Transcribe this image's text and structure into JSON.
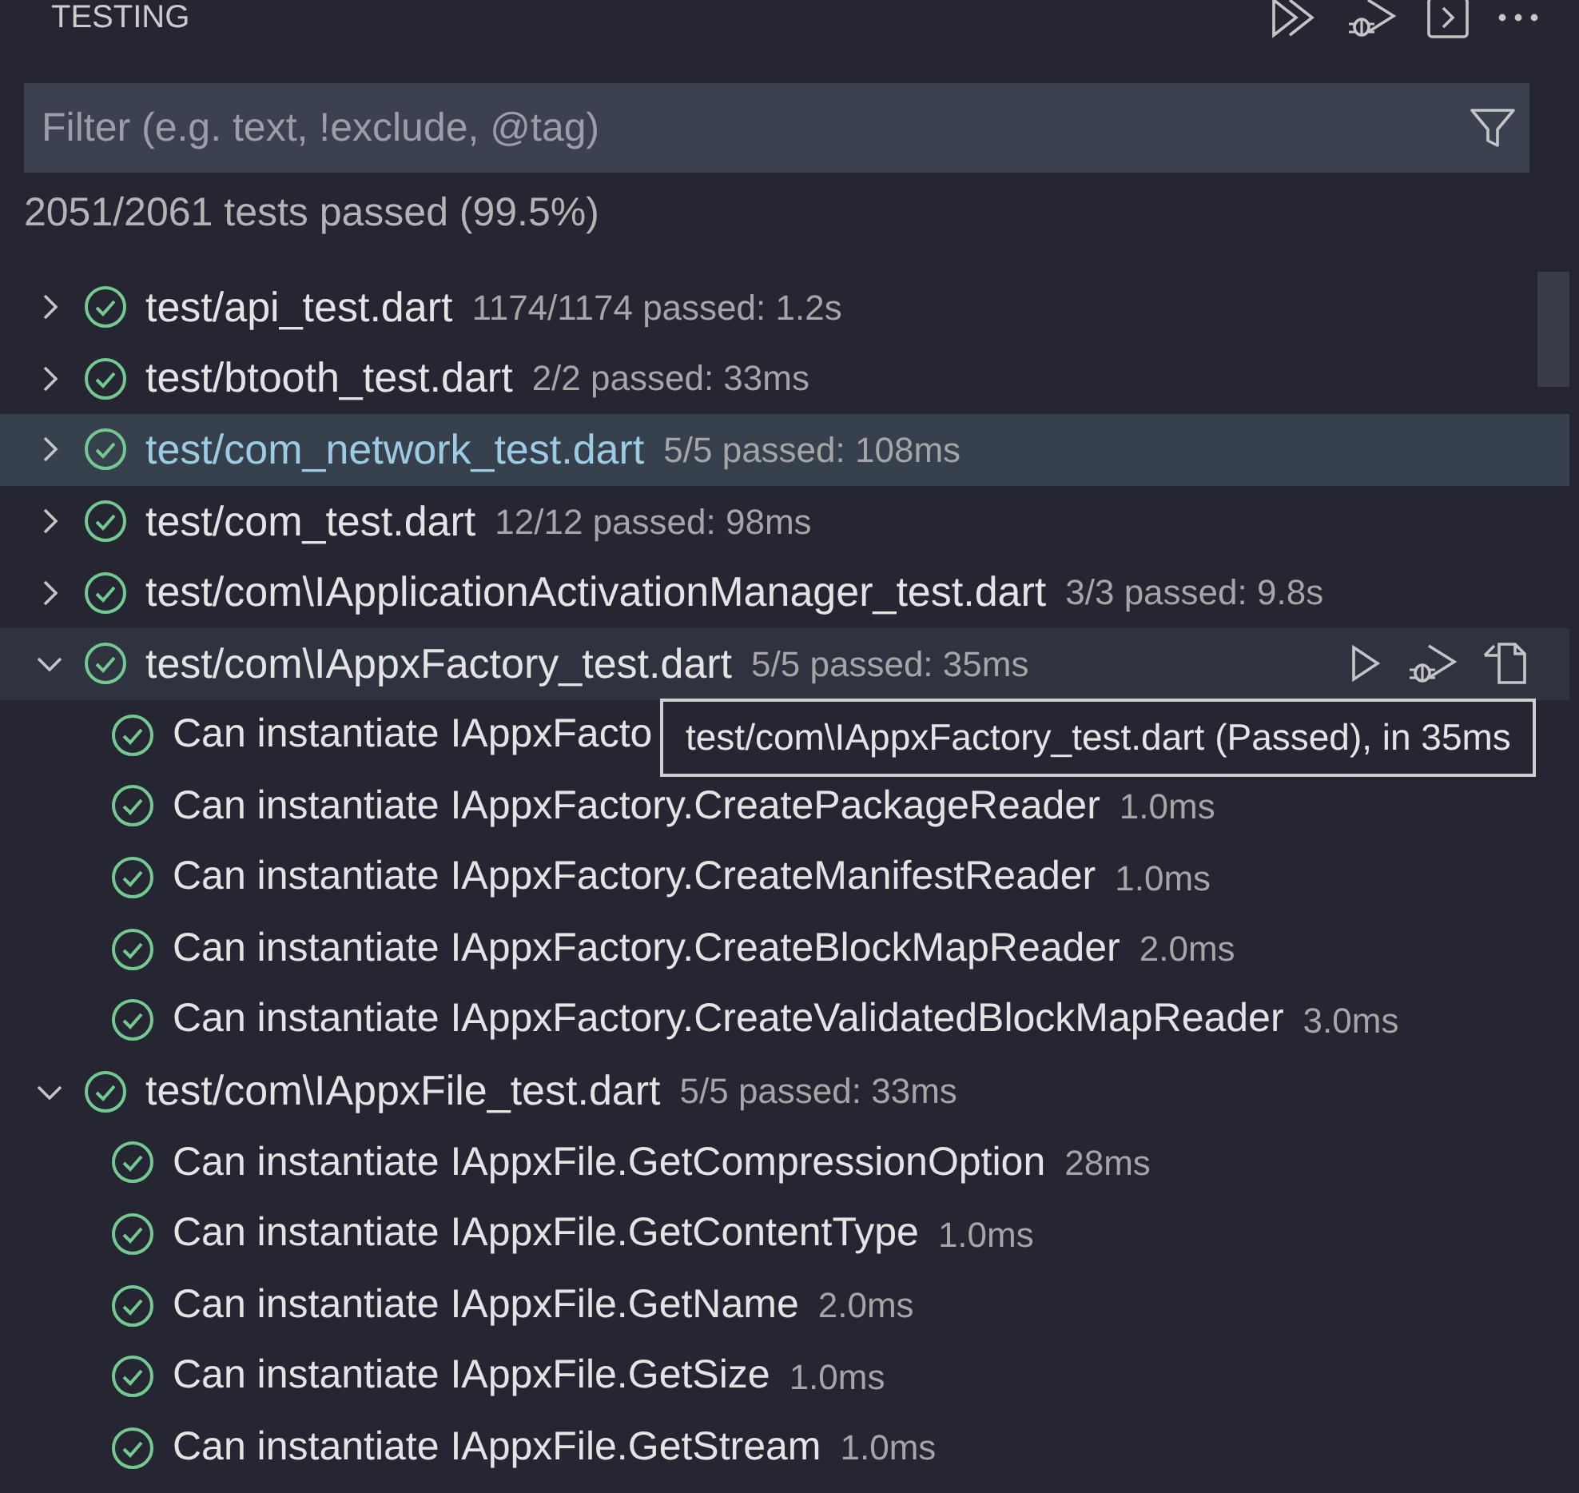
{
  "panel": {
    "title": "TESTING"
  },
  "filter": {
    "placeholder": "Filter (e.g. text, !exclude, @tag)"
  },
  "summary": "2051/2061 tests passed (99.5%)",
  "tree": [
    {
      "label": "test/api_test.dart",
      "detail": "1174/1174 passed: 1.2s",
      "expanded": false,
      "selected": false,
      "hovered": false
    },
    {
      "label": "test/btooth_test.dart",
      "detail": "2/2 passed: 33ms",
      "expanded": false,
      "selected": false,
      "hovered": false
    },
    {
      "label": "test/com_network_test.dart",
      "detail": "5/5 passed: 108ms",
      "expanded": false,
      "selected": true,
      "hovered": false
    },
    {
      "label": "test/com_test.dart",
      "detail": "12/12 passed: 98ms",
      "expanded": false,
      "selected": false,
      "hovered": false
    },
    {
      "label": "test/com\\IApplicationActivationManager_test.dart",
      "detail": "3/3 passed: 9.8s",
      "expanded": false,
      "selected": false,
      "hovered": false
    },
    {
      "label": "test/com\\IAppxFactory_test.dart",
      "detail": "5/5 passed: 35ms",
      "expanded": true,
      "selected": false,
      "hovered": true,
      "children": [
        {
          "label": "Can instantiate IAppxFacto"
        },
        {
          "label": "Can instantiate IAppxFactory.CreatePackageReader",
          "detail": "1.0ms"
        },
        {
          "label": "Can instantiate IAppxFactory.CreateManifestReader",
          "detail": "1.0ms"
        },
        {
          "label": "Can instantiate IAppxFactory.CreateBlockMapReader",
          "detail": "2.0ms"
        },
        {
          "label": "Can instantiate IAppxFactory.CreateValidatedBlockMapReader",
          "detail": "3.0ms"
        }
      ]
    },
    {
      "label": "test/com\\IAppxFile_test.dart",
      "detail": "5/5 passed: 33ms",
      "expanded": true,
      "selected": false,
      "hovered": false,
      "children": [
        {
          "label": "Can instantiate IAppxFile.GetCompressionOption",
          "detail": "28ms"
        },
        {
          "label": "Can instantiate IAppxFile.GetContentType",
          "detail": "1.0ms"
        },
        {
          "label": "Can instantiate IAppxFile.GetName",
          "detail": "2.0ms"
        },
        {
          "label": "Can instantiate IAppxFile.GetSize",
          "detail": "1.0ms"
        },
        {
          "label": "Can instantiate IAppxFile.GetStream",
          "detail": "1.0ms"
        }
      ]
    }
  ],
  "tooltip": "test/com\\IAppxFactory_test.dart (Passed), in 35ms"
}
